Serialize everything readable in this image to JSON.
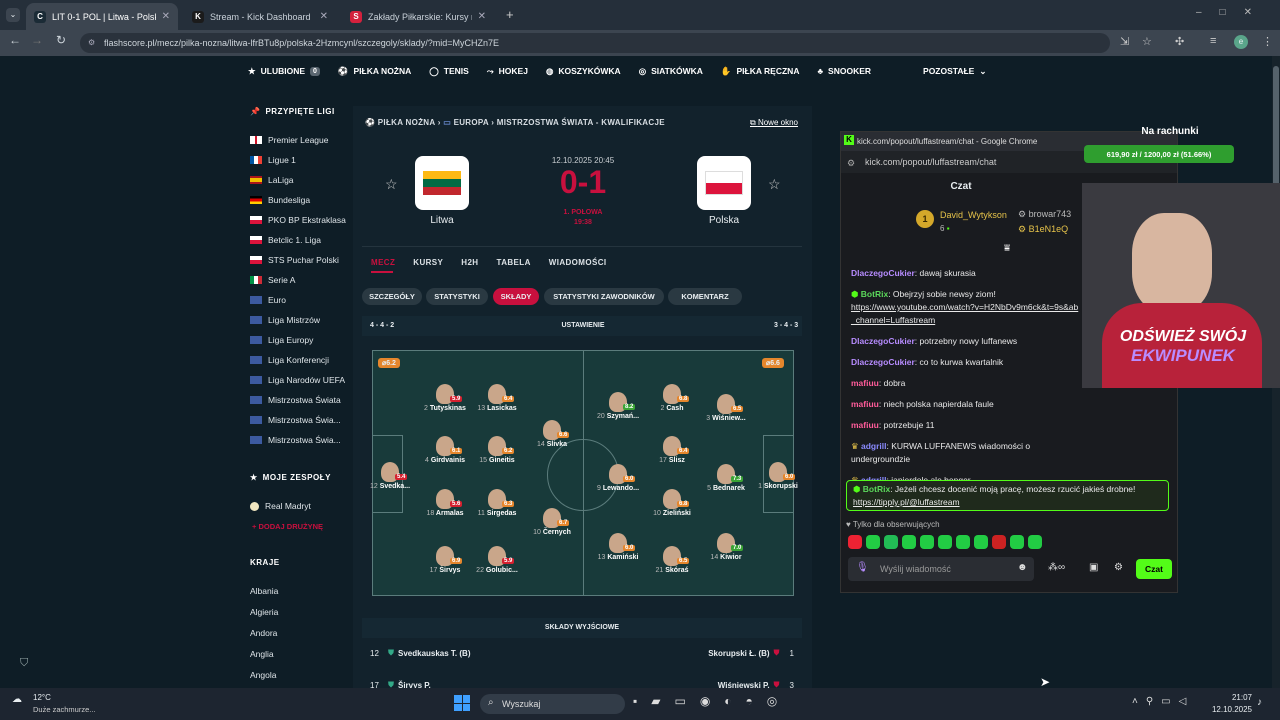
{
  "browser": {
    "tabs": [
      {
        "title": "LIT 0-1 POL | Litwa - Polska NA",
        "fav": "C",
        "favcolor": "#1b2b36"
      },
      {
        "title": "Stream - Kick Dashboard",
        "fav": "K",
        "favcolor": "#1b1b1b"
      },
      {
        "title": "Zakłady Piłkarskie: Kursy na Piłk",
        "fav": "S",
        "favcolor": "#d4213d"
      }
    ],
    "new_tab": "+",
    "url": "flashscore.pl/mecz/pilka-nozna/litwa-lfrBTu8p/polska-2Hzmcynl/szczegoly/sklady/?mid=MyCHZn7E",
    "profile": "e"
  },
  "nav": {
    "items": [
      "ULUBIONE",
      "PIŁKA NOŻNA",
      "TENIS",
      "HOKEJ",
      "KOSZYKÓWKA",
      "SIATKÓWKA",
      "PIŁKA RĘCZNA",
      "SNOOKER"
    ],
    "fav_count": "0",
    "more": "POZOSTAŁE"
  },
  "left": {
    "pinned_title": "PRZYPIĘTE LIGI",
    "leagues": [
      "Premier League",
      "Ligue 1",
      "LaLiga",
      "Bundesliga",
      "PKO BP Ekstraklasa",
      "Betclic 1. Liga",
      "STS Puchar Polski",
      "Serie A",
      "Euro",
      "Liga Mistrzów",
      "Liga Europy",
      "Liga Konferencji",
      "Liga Narodów UEFA",
      "Mistrzostwa Świata",
      "Mistrzostwa Świa...",
      "Mistrzostwa Świa..."
    ],
    "teams_title": "MOJE ZESPOŁY",
    "team": "Real Madryt",
    "add_team": "DODAJ DRUŻYNĘ",
    "countries_title": "KRAJE",
    "countries": [
      "Albania",
      "Algieria",
      "Andora",
      "Anglia",
      "Angola"
    ]
  },
  "match": {
    "breadcrumb": [
      "PIŁKA NOŻNA",
      "EUROPA",
      "MISTRZOSTWA ŚWIATA - KWALIFIKACJE"
    ],
    "new_window": "Nowe okno",
    "date": "12.10.2025 20:45",
    "score": "0-1",
    "status": "1. POŁOWA",
    "minute": "19:38",
    "home": "Litwa",
    "away": "Polska",
    "tabs": [
      "MECZ",
      "KURSY",
      "H2H",
      "TABELA",
      "WIADOMOŚCI"
    ],
    "subtabs": [
      "SZCZEGÓŁY",
      "STATYSTYKI",
      "SKŁADY",
      "STATYSTYKI ZAWODNIKÓW",
      "KOMENTARZ"
    ],
    "home_formation": "4 - 4 - 2",
    "lineup_title": "USTAWIENIE",
    "away_formation": "3 - 4 - 3",
    "home_rating": "6.2",
    "away_rating": "6.6",
    "starting_title": "SKŁADY WYJŚCIOWE",
    "rows": [
      {
        "hn": "12",
        "hp": "Svedkauskas T. (B)",
        "ap": "Skorupski Ł. (B)",
        "an": "1"
      },
      {
        "hn": "17",
        "hp": "Širvys P.",
        "ap": "Wiśniewski P.",
        "an": "3"
      }
    ]
  },
  "players": [
    {
      "n": "12",
      "name": "Svedka...",
      "r": "5.4",
      "rc": "#d5202f"
    },
    {
      "n": "4",
      "name": "Girdvainis",
      "r": "6.1",
      "rc": "#e5862c"
    },
    {
      "n": "2",
      "name": "Tutyskinas",
      "r": "5.9",
      "rc": "#d5202f"
    },
    {
      "n": "18",
      "name": "Armalas",
      "r": "5.6",
      "rc": "#d5202f"
    },
    {
      "n": "17",
      "name": "Širvys",
      "r": "6.9",
      "rc": "#e5862c"
    },
    {
      "n": "13",
      "name": "Lasickas",
      "r": "6.4",
      "rc": "#e5862c"
    },
    {
      "n": "15",
      "name": "Gineitis",
      "r": "6.2",
      "rc": "#e5862c"
    },
    {
      "n": "11",
      "name": "Sirgedas",
      "r": "6.3",
      "rc": "#e5862c"
    },
    {
      "n": "22",
      "name": "Golubic...",
      "r": "5.9",
      "rc": "#d5202f"
    },
    {
      "n": "14",
      "name": "Slivka",
      "r": "6.6",
      "rc": "#e5862c"
    },
    {
      "n": "10",
      "name": "Černych",
      "r": "6.7",
      "rc": "#e5862c"
    },
    {
      "n": "20",
      "name": "Szymań...",
      "r": "8.2",
      "rc": "#3aa435"
    },
    {
      "n": "9",
      "name": "Lewando...",
      "r": "6.0",
      "rc": "#e5862c"
    },
    {
      "n": "13",
      "name": "Kamiński",
      "r": "6.0",
      "rc": "#e5862c"
    },
    {
      "n": "2",
      "name": "Cash",
      "r": "6.8",
      "rc": "#e5862c"
    },
    {
      "n": "17",
      "name": "Slisz",
      "r": "6.4",
      "rc": "#e5862c"
    },
    {
      "n": "10",
      "name": "Zieliński",
      "r": "6.8",
      "rc": "#e5862c"
    },
    {
      "n": "21",
      "name": "Skóraś",
      "r": "6.5",
      "rc": "#e5862c"
    },
    {
      "n": "3",
      "name": "Wiśniew...",
      "r": "6.5",
      "rc": "#e5862c"
    },
    {
      "n": "5",
      "name": "Bednarek",
      "r": "7.3",
      "rc": "#3aa435"
    },
    {
      "n": "14",
      "name": "Kiwior",
      "r": "7.0",
      "rc": "#3aa435"
    },
    {
      "n": "1",
      "name": "Skorupski",
      "r": "6.0",
      "rc": "#e5862c"
    }
  ],
  "chat": {
    "window_title": "kick.com/popout/luffastream/chat - Google Chrome",
    "url": "kick.com/popout/luffastream/chat",
    "title": "Czat",
    "top_user": "David_Wytykson",
    "top_count": "6",
    "gift1": "browar743",
    "gift2": "B1eN1eQ",
    "messages": [
      {
        "u": "DlaczegoCukier",
        "c": "u1",
        "t": "dawaj skurasia"
      },
      {
        "u": "BotRix",
        "c": "u4",
        "t": "Obejrzyj sobie newsy ziom!",
        "link": "https://www.youtube.com/watch?v=H2NbDv9m6ck&t=9s&ab_channel=Luffastream"
      },
      {
        "u": "DlaczegoCukier",
        "c": "u1",
        "t": "potrzebny nowy luffanews"
      },
      {
        "u": "DlaczegoCukier",
        "c": "u1",
        "t": "co to kurwa kwartalnik"
      },
      {
        "u": "mafiuu",
        "c": "u2",
        "t": "dobra"
      },
      {
        "u": "mafiuu",
        "c": "u2",
        "t": "niech polska napierdala faule"
      },
      {
        "u": "mafiuu",
        "c": "u2",
        "t": "potrzebuje 11"
      },
      {
        "u": "adgrill",
        "c": "u3",
        "t": "KURWA LUFFANEWS wiadomości o undergroundzie"
      },
      {
        "u": "adgrill",
        "c": "u3",
        "t": "japierdole ale benger"
      }
    ],
    "pinned": {
      "u": "BotRix",
      "t": "Jeżeli chcesz docenić moją pracę, możesz rzucić jakieś drobne!",
      "link": "https://tipply.pl/@luffastream"
    },
    "followers_only": "Tylko dla obserwujących",
    "input_placeholder": "Wyślij wiadomość",
    "send": "Czat"
  },
  "stream": {
    "goal_title": "Na rachunki",
    "goal": "619,90 zł / 1200,00 zł (51.66%)",
    "goal_progress": 0.5166,
    "banner_1": "ODŚWIEŻ SWÓJ",
    "banner_2": "EKWIPUNEK"
  },
  "taskbar": {
    "temp": "12°C",
    "weather": "Duże zachmurze...",
    "search": "Wyszukaj",
    "time": "21:07",
    "date": "12.10.2025"
  }
}
